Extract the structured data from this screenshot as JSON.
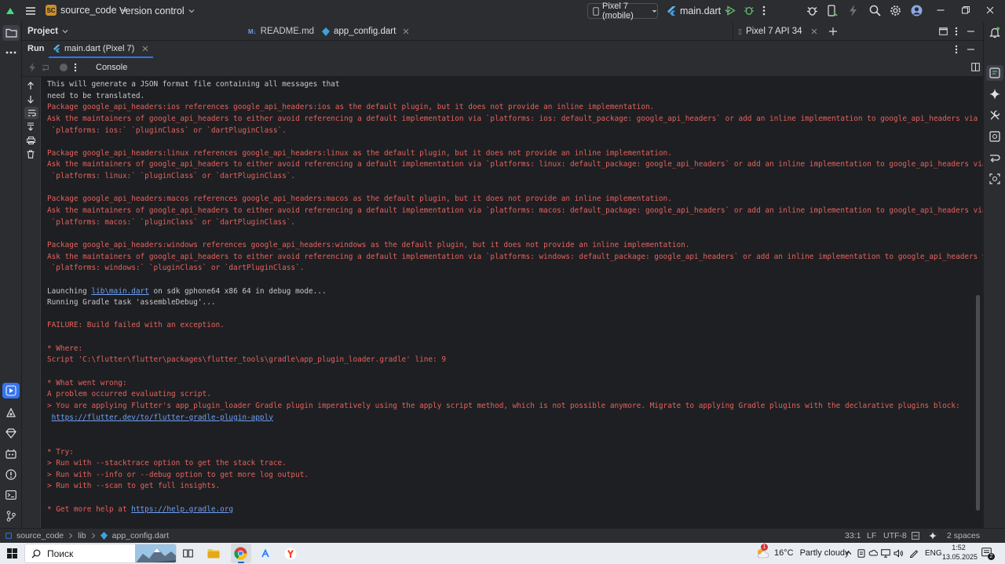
{
  "titlebar": {
    "project_badge": "SC",
    "project_name": "source_code",
    "vcs_label": "Version control",
    "device": "Pixel 7 (mobile)",
    "run_config": "main.dart"
  },
  "project_panel": {
    "label": "Project"
  },
  "editor_tabs": [
    {
      "label": "README.md",
      "icon": "markdown-icon"
    },
    {
      "label": "app_config.dart",
      "icon": "dart-file-icon"
    }
  ],
  "emulator_tab": {
    "label": "Pixel 7 API 34"
  },
  "run_window": {
    "title": "Run",
    "active_tab": "main.dart (Pixel 7)",
    "console_tab": "Console"
  },
  "console": {
    "lines": [
      {
        "type": "normal",
        "text": "This will generate a JSON format file containing all messages that"
      },
      {
        "type": "normal",
        "text": "need to be translated."
      },
      {
        "type": "error",
        "text": "Package google_api_headers:ios references google_api_headers:ios as the default plugin, but it does not provide an inline implementation."
      },
      {
        "type": "error",
        "text": "Ask the maintainers of google_api_headers to either avoid referencing a default implementation via `platforms: ios: default_package: google_api_headers` or add an inline implementation to google_api_headers via"
      },
      {
        "type": "error",
        "text": " `platforms: ios:` `pluginClass` or `dartPluginClass`."
      },
      {
        "type": "error",
        "text": ""
      },
      {
        "type": "error",
        "text": "Package google_api_headers:linux references google_api_headers:linux as the default plugin, but it does not provide an inline implementation."
      },
      {
        "type": "error",
        "text": "Ask the maintainers of google_api_headers to either avoid referencing a default implementation via `platforms: linux: default_package: google_api_headers` or add an inline implementation to google_api_headers via"
      },
      {
        "type": "error",
        "text": " `platforms: linux:` `pluginClass` or `dartPluginClass`."
      },
      {
        "type": "error",
        "text": ""
      },
      {
        "type": "error",
        "text": "Package google_api_headers:macos references google_api_headers:macos as the default plugin, but it does not provide an inline implementation."
      },
      {
        "type": "error",
        "text": "Ask the maintainers of google_api_headers to either avoid referencing a default implementation via `platforms: macos: default_package: google_api_headers` or add an inline implementation to google_api_headers via"
      },
      {
        "type": "error",
        "text": " `platforms: macos:` `pluginClass` or `dartPluginClass`."
      },
      {
        "type": "error",
        "text": ""
      },
      {
        "type": "error",
        "text": "Package google_api_headers:windows references google_api_headers:windows as the default plugin, but it does not provide an inline implementation."
      },
      {
        "type": "error",
        "text": "Ask the maintainers of google_api_headers to either avoid referencing a default implementation via `platforms: windows: default_package: google_api_headers` or add an inline implementation to google_api_headers via"
      },
      {
        "type": "error",
        "text": " `platforms: windows:` `pluginClass` or `dartPluginClass`."
      },
      {
        "type": "error",
        "text": ""
      },
      {
        "type": "normal",
        "text": "Launching ",
        "link": "lib\\main.dart",
        "after": " on sdk gphone64 x86 64 in debug mode..."
      },
      {
        "type": "normal",
        "text": "Running Gradle task 'assembleDebug'..."
      },
      {
        "type": "error",
        "text": ""
      },
      {
        "type": "error",
        "text": "FAILURE: Build failed with an exception."
      },
      {
        "type": "error",
        "text": ""
      },
      {
        "type": "error",
        "text": "* Where:"
      },
      {
        "type": "error",
        "text": "Script 'C:\\flutter\\flutter\\packages\\flutter_tools\\gradle\\app_plugin_loader.gradle' line: 9"
      },
      {
        "type": "error",
        "text": ""
      },
      {
        "type": "error",
        "text": "* What went wrong:"
      },
      {
        "type": "error",
        "text": "A problem occurred evaluating script."
      },
      {
        "type": "error",
        "text": "> You are applying Flutter's app_plugin_loader Gradle plugin imperatively using the apply script method, which is not possible anymore. Migrate to applying Gradle plugins with the declarative plugins block:"
      },
      {
        "type": "error",
        "text": " ",
        "link": "https://flutter.dev/to/flutter-gradle-plugin-apply",
        "after": ""
      },
      {
        "type": "error",
        "text": ""
      },
      {
        "type": "error",
        "text": ""
      },
      {
        "type": "error",
        "text": "* Try:"
      },
      {
        "type": "error",
        "text": "> Run with --stacktrace option to get the stack trace."
      },
      {
        "type": "error",
        "text": "> Run with --info or --debug option to get more log output."
      },
      {
        "type": "error",
        "text": "> Run with --scan to get full insights."
      },
      {
        "type": "error",
        "text": ""
      },
      {
        "type": "error",
        "text": "* Get more help at ",
        "link": "https://help.gradle.org",
        "after": ""
      }
    ]
  },
  "statusbar": {
    "breadcrumb": [
      "source_code",
      "lib",
      "app_config.dart"
    ],
    "position": "33:1",
    "line_sep": "LF",
    "encoding": "UTF-8",
    "indent": "2 spaces"
  },
  "taskbar": {
    "search_placeholder": "Поиск",
    "weather_temp": "16°C",
    "weather_text": "Partly cloudy",
    "weather_badge": "1",
    "lang": "ENG",
    "time": "1:52",
    "date": "13.05.2025",
    "notif_count": "2"
  },
  "colors": {
    "accent": "#3574f0",
    "error_text": "#e5625d",
    "link": "#6f9ff5",
    "run_green": "#5fb865"
  }
}
